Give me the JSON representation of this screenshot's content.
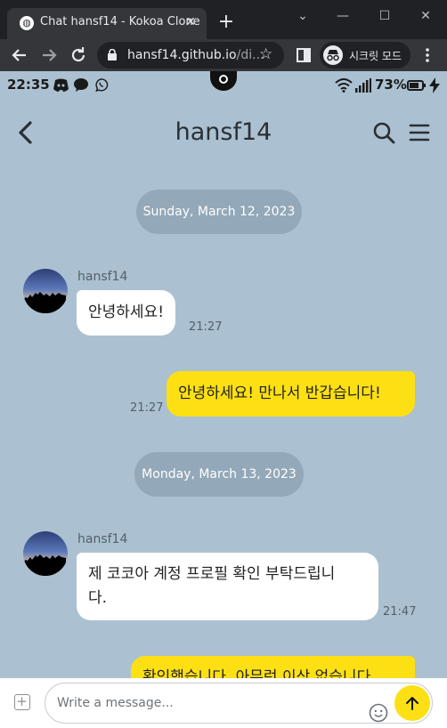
{
  "browser": {
    "tab_title": "Chat hansf14 - Kokoa Clone",
    "tab_close": "✕",
    "new_tab": "+",
    "url_host": "hansf14.github.io",
    "url_rest": "/di...",
    "incognito_label": "시크릿 모드",
    "window_minimize": "—",
    "window_maximize": "☐",
    "window_close": "✕",
    "window_chevron": "⌄"
  },
  "status_bar": {
    "time": "22:35",
    "battery": "73%",
    "apps": [
      "discord-icon",
      "chat-bubble-icon",
      "viber-icon"
    ]
  },
  "chat": {
    "title": "hansf14"
  },
  "messages": {
    "day1": {
      "date": "Sunday, March 12, 2023",
      "in_sender": "hansf14",
      "in_text": "안녕하세요!",
      "in_time": "21:27",
      "out_text": "안녕하세요! 만나서 반갑습니다!",
      "out_time": "21:27"
    },
    "day2": {
      "date": "Monday, March 13, 2023",
      "in_sender": "hansf14",
      "in_text_line1": "제 코코아 계정 프로필 확인 부탁드립니",
      "in_text_line2": "다.",
      "in_time": "21:47",
      "out_text_partial": "확인했습니다. 아무런 이상 없습니다"
    }
  },
  "composer": {
    "placeholder": "Write a message..."
  },
  "colors": {
    "background": "#abc1d1",
    "outgoing_bubble": "#fde013",
    "incoming_bubble": "#ffffff",
    "date_pill": "#93a8b8"
  }
}
